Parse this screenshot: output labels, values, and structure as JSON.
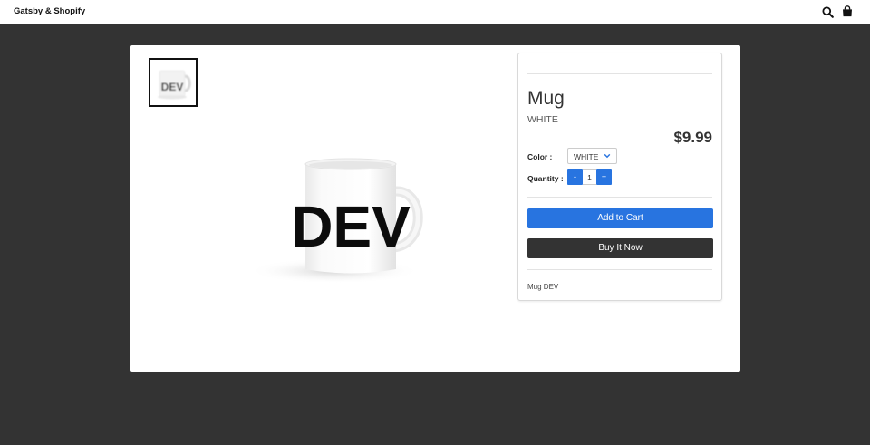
{
  "header": {
    "brand": "Gatsby & Shopify",
    "icons": [
      "search-icon",
      "shopping-bag-icon"
    ]
  },
  "gallery": {
    "thumbnail_text": "DEV",
    "main_image_text": "DEV"
  },
  "product": {
    "title": "Mug",
    "variant": "WHITE",
    "price": "$9.99",
    "color_label": "Color :",
    "color_selected": "WHITE",
    "quantity_label": "Quantity :",
    "quantity_minus": "-",
    "quantity_value": "1",
    "quantity_plus": "+",
    "add_to_cart": "Add to Cart",
    "buy_now": "Buy It Now",
    "description": "Mug DEV"
  },
  "colors": {
    "background": "#333333",
    "accent": "#2874e0",
    "buy_button": "#333333"
  }
}
